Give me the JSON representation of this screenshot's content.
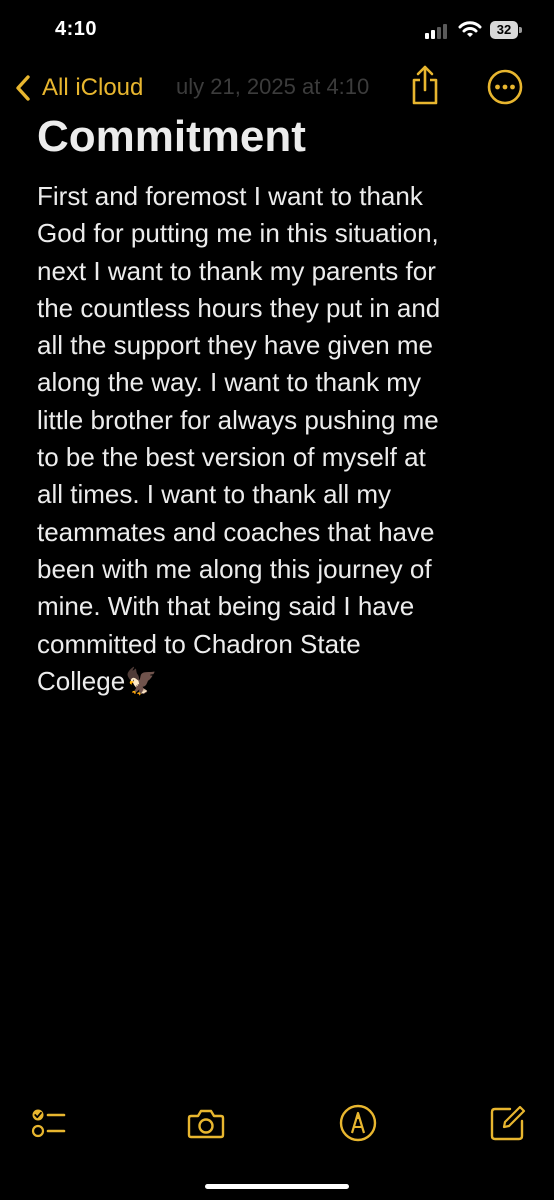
{
  "status_bar": {
    "time": "4:10",
    "battery": "32"
  },
  "nav": {
    "back_label": "All iCloud",
    "faded_date": "uly 21, 2025 at 4:10"
  },
  "note": {
    "title": "Commitment",
    "lines": [
      "First and foremost I want to thank",
      "God for putting me in this situation,",
      "next I want to thank my parents for",
      "the countless hours they put in and",
      "all the support they have given me",
      "along the way. I want to thank my",
      "little brother for always pushing me",
      "to be the best version of myself at",
      "all times. I want to thank all my",
      "teammates and coaches that have",
      "been with me along this journey of",
      "mine. With that being said I have",
      "committed to Chadron State",
      "College🦅"
    ]
  },
  "toolbar": {
    "items": [
      "checklist-icon",
      "camera-icon",
      "markup-pen-icon",
      "compose-icon"
    ]
  },
  "colors": {
    "accent": "#e8b62f",
    "background": "#000000",
    "text": "#ececec"
  }
}
